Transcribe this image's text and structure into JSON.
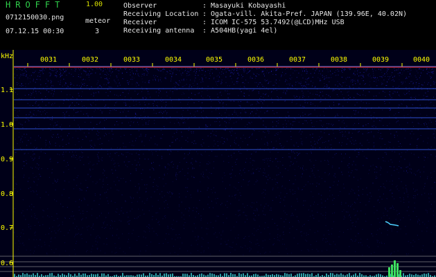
{
  "header": {
    "app_title": "HROFFT",
    "app_version": "1.00",
    "filename": "0712150030.png",
    "datetime": "07.12.15 00:30",
    "meteor_label": "meteor",
    "meteor_count": "3",
    "info": [
      {
        "label": "Observer",
        "value": ": Masayuki Kobayashi"
      },
      {
        "label": "Receiving Location",
        "value": ": Ogata-vill. Akita-Pref. JAPAN (139.96E, 40.02N)"
      },
      {
        "label": "Receiver",
        "value": ": ICOM IC-575 53.7492(@LCD)MHz USB"
      },
      {
        "label": "Receiving antenna",
        "value": ": A504HB(yagi 4el)"
      }
    ]
  },
  "axis": {
    "unit": "kHz",
    "y_labels": [
      "1.1",
      "1.0",
      "0.9",
      "0.8",
      "0.7",
      "0.6"
    ],
    "x_labels": [
      "0031",
      "0032",
      "0033",
      "0034",
      "0035",
      "0036",
      "0037",
      "0038",
      "0039",
      "0040"
    ]
  },
  "colors": {
    "background": "#000000",
    "spectrum_bg": "#000018",
    "noise": "#1c1ca8",
    "line": "#3a66ff",
    "marker": "#ff3030",
    "axis": "#ffff00",
    "title": "#2fd14b",
    "text": "#e8e8e8"
  }
}
